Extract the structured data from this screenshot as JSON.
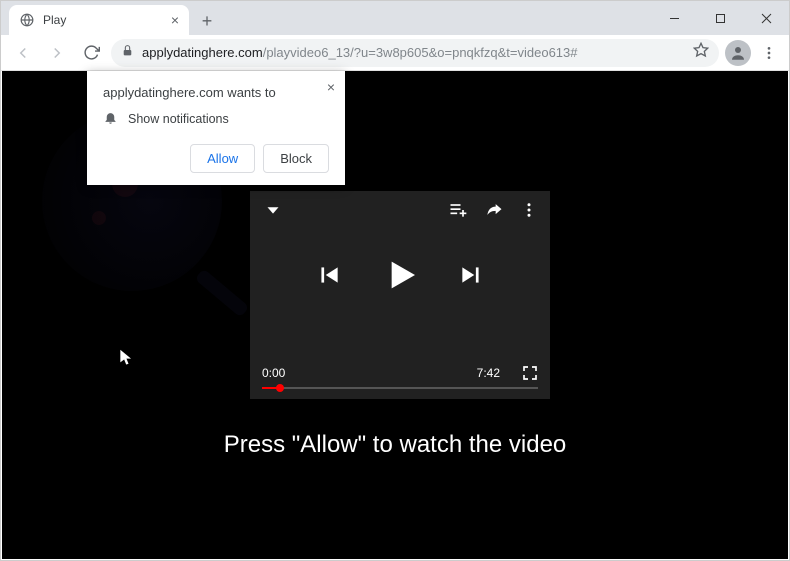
{
  "tab": {
    "title": "Play"
  },
  "address": {
    "domain": "applydatinghere.com",
    "path": "/playvideo6_13/?u=3w8p605&o=pnqkfzq&t=video613#"
  },
  "notification": {
    "origin_line": "applydatinghere.com wants to",
    "permission_line": "Show notifications",
    "allow_label": "Allow",
    "block_label": "Block"
  },
  "player": {
    "current_time": "0:00",
    "duration": "7:42"
  },
  "page": {
    "message": "Press \"Allow\" to watch the video"
  },
  "icons": {
    "globe": "globe-icon",
    "close": "×",
    "plus": "+",
    "min": "—",
    "max": "□",
    "winclose": "✕"
  }
}
